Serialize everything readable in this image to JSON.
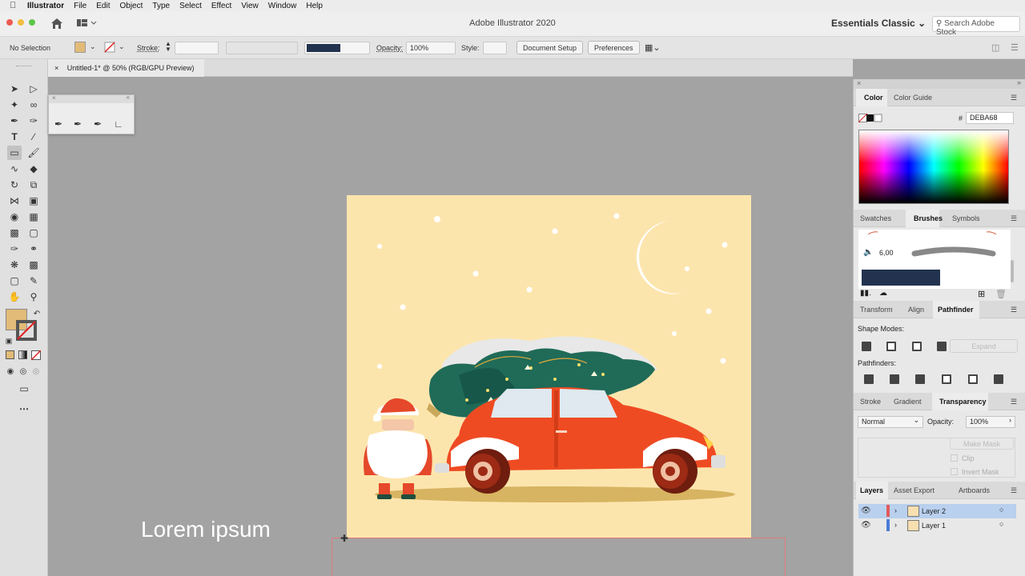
{
  "menubar": {
    "apple": "",
    "app": "Illustrator",
    "items": [
      "File",
      "Edit",
      "Object",
      "Type",
      "Select",
      "Effect",
      "View",
      "Window",
      "Help"
    ]
  },
  "appbar": {
    "title": "Adobe Illustrator 2020",
    "workspace": "Essentials Classic",
    "search_placeholder": "Search Adobe Stock"
  },
  "control": {
    "selection": "No Selection",
    "stroke_label": "Stroke:",
    "opacity_label": "Opacity:",
    "opacity_value": "100%",
    "style_label": "Style:",
    "document_setup": "Document Setup",
    "preferences": "Preferences",
    "fill_color": "#e2bb78"
  },
  "document_tab": {
    "close": "×",
    "name": "Untitled-1* @ 50% (RGB/GPU Preview)"
  },
  "canvas": {
    "lorem": "Lorem ipsum",
    "artboard_bg": "#fce5ad"
  },
  "panels": {
    "color_tabs": [
      "Color",
      "Color Guide"
    ],
    "hex_symbol": "#",
    "hex_value": "DEBA68",
    "swatch_tabs": [
      "Swatches",
      "Brushes",
      "Symbols"
    ],
    "brush_size": "6,00",
    "transform_tabs": [
      "Transform",
      "Align",
      "Pathfinder"
    ],
    "shape_modes": "Shape Modes:",
    "expand": "Expand",
    "pathfinders": "Pathfinders:",
    "stroke_tabs": [
      "Stroke",
      "Gradient",
      "Transparency"
    ],
    "blend_mode": "Normal",
    "opacity_label": "Opacity:",
    "opacity_value": "100%",
    "make_mask": "Make Mask",
    "clip": "Clip",
    "invert_mask": "Invert Mask",
    "layer_tabs": [
      "Layers",
      "Asset Export",
      "Artboards"
    ],
    "layers": [
      {
        "name": "Layer 2",
        "color": "#e25a5a"
      },
      {
        "name": "Layer 1",
        "color": "#4b7cd6"
      }
    ]
  }
}
